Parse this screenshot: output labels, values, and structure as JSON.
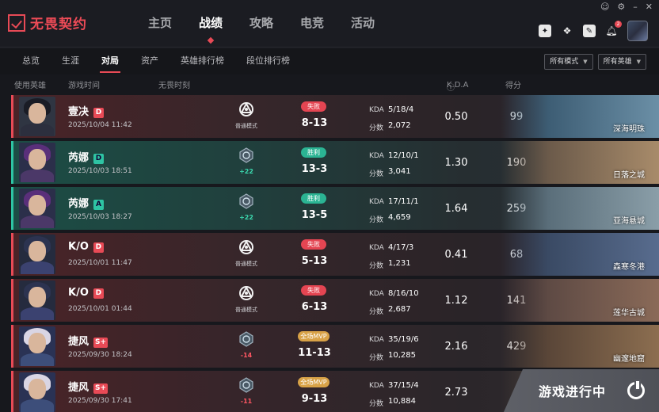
{
  "logo": {
    "text": "无畏契约"
  },
  "nav": [
    {
      "label": "主页"
    },
    {
      "label": "战绩"
    },
    {
      "label": "攻略"
    },
    {
      "label": "电竞"
    },
    {
      "label": "活动"
    }
  ],
  "notifications": {
    "count": "2"
  },
  "subnav": [
    {
      "label": "总览"
    },
    {
      "label": "生涯"
    },
    {
      "label": "对局"
    },
    {
      "label": "资产"
    },
    {
      "label": "英雄排行榜"
    },
    {
      "label": "段位排行榜"
    }
  ],
  "filters": {
    "mode": "所有模式",
    "hero": "所有英雄"
  },
  "columns": {
    "hero": "使用英雄",
    "time": "游戏时间",
    "moment": "无畏时刻",
    "kda": "K.D.A",
    "score": "得分"
  },
  "labels": {
    "kda": "KDA",
    "points": "分数"
  },
  "colors": {
    "loss": "#e84a56",
    "win": "#2ec4a3",
    "mvp": "#d8a247"
  },
  "matches": [
    {
      "agent": "壹决",
      "rank": "D",
      "date": "2025/10/04 11:42",
      "mode_label": "普通模式",
      "delta": "",
      "result": "失败",
      "score": "8-13",
      "kda": "5/18/4",
      "points": "2,072",
      "ratio": "0.50",
      "total": "99",
      "map": "深海明珠"
    },
    {
      "agent": "芮娜",
      "rank": "D",
      "date": "2025/10/03 18:51",
      "mode_label": "",
      "delta": "+22",
      "result": "胜利",
      "score": "13-3",
      "kda": "12/10/1",
      "points": "3,041",
      "ratio": "1.30",
      "total": "190",
      "map": "日落之城"
    },
    {
      "agent": "芮娜",
      "rank": "A",
      "date": "2025/10/03 18:27",
      "mode_label": "",
      "delta": "+22",
      "result": "胜利",
      "score": "13-5",
      "kda": "17/11/1",
      "points": "4,659",
      "ratio": "1.64",
      "total": "259",
      "map": "亚海悬城"
    },
    {
      "agent": "K/O",
      "rank": "D",
      "date": "2025/10/01 11:47",
      "mode_label": "普通模式",
      "delta": "",
      "result": "失败",
      "score": "5-13",
      "kda": "4/17/3",
      "points": "1,231",
      "ratio": "0.41",
      "total": "68",
      "map": "森寒冬港"
    },
    {
      "agent": "K/O",
      "rank": "D",
      "date": "2025/10/01 01:44",
      "mode_label": "普通模式",
      "delta": "",
      "result": "失败",
      "score": "6-13",
      "kda": "8/16/10",
      "points": "2,687",
      "ratio": "1.12",
      "total": "141",
      "map": "莲华古城"
    },
    {
      "agent": "捷风",
      "rank": "S+",
      "date": "2025/09/30 18:24",
      "mode_label": "",
      "delta": "-14",
      "result": "全场MVP",
      "score": "11-13",
      "kda": "35/19/6",
      "points": "10,285",
      "ratio": "2.16",
      "total": "429",
      "map": "幽邃地窟"
    },
    {
      "agent": "捷风",
      "rank": "S+",
      "date": "2025/09/30 17:41",
      "mode_label": "",
      "delta": "-11",
      "result": "全场MVP",
      "score": "9-13",
      "kda": "37/15/4",
      "points": "10,884",
      "ratio": "2.73",
      "total": "",
      "map": ""
    }
  ],
  "banner": {
    "text": "游戏进行中"
  }
}
